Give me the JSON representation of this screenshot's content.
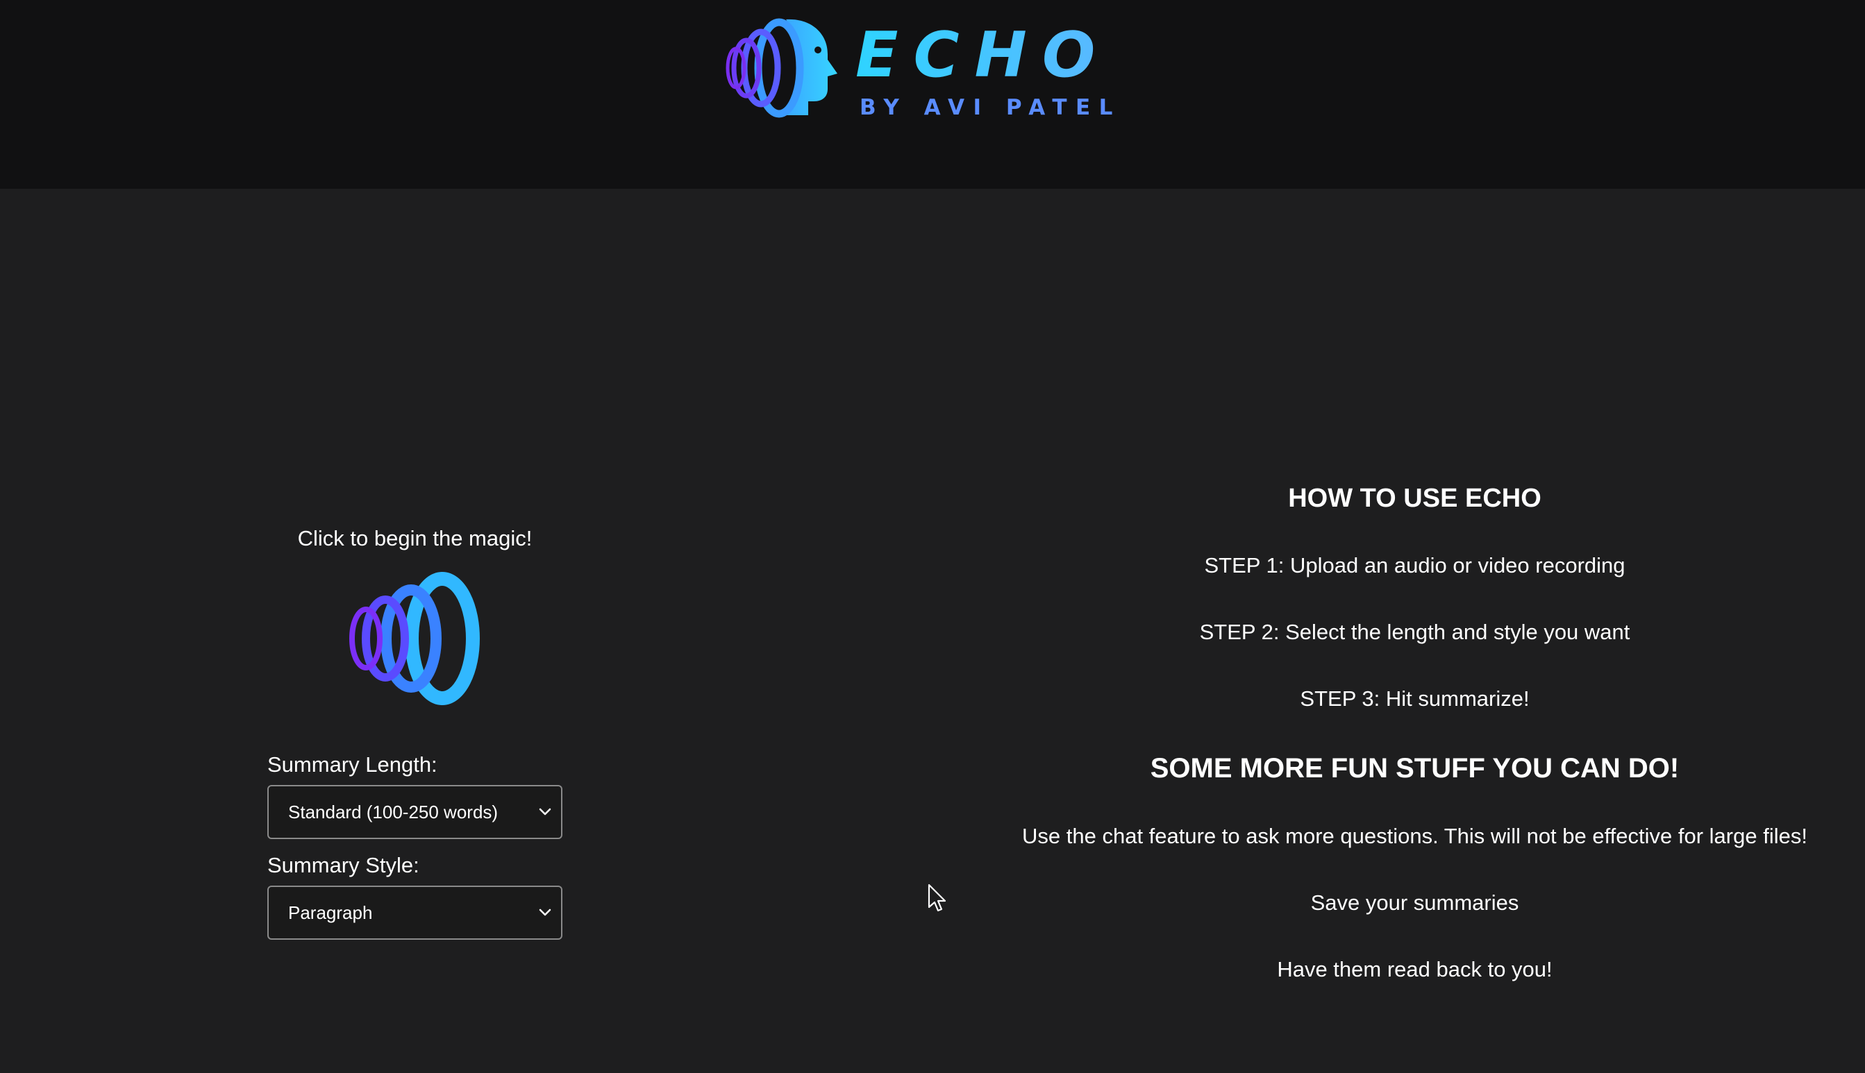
{
  "header": {
    "brand_title": "ECHO",
    "brand_subtitle": "BY AVI PATEL",
    "logo_icon": "head-soundwave-icon",
    "colors": {
      "background": "#111112",
      "title_gradient_start": "#2fd3ff",
      "title_gradient_end": "#5ab8ff",
      "subtitle": "#5a8cff"
    }
  },
  "upload": {
    "prompt": "Click to begin the magic!",
    "icon": "soundwave-icon",
    "icon_colors": [
      "#7b2ff7",
      "#5a4bff",
      "#3a82ff",
      "#31b8ff"
    ]
  },
  "settings": {
    "length_label": "Summary Length:",
    "length_value": "Standard (100-250 words)",
    "style_label": "Summary Style:",
    "style_value": "Paragraph"
  },
  "instructions": {
    "heading": "HOW TO USE ECHO",
    "steps": [
      "STEP 1: Upload an audio or video recording",
      "STEP 2: Select the length and style you want",
      "STEP 3: Hit summarize!"
    ],
    "extras_heading": "SOME MORE FUN STUFF YOU CAN DO!",
    "extras": [
      "Use the chat feature to ask more questions. This will not be effective for large files!",
      "Save your summaries",
      "Have them read back to you!"
    ]
  },
  "theme": {
    "page_background": "#1e1e1f",
    "text": "#ffffff",
    "select_border": "#8a8a8a"
  }
}
